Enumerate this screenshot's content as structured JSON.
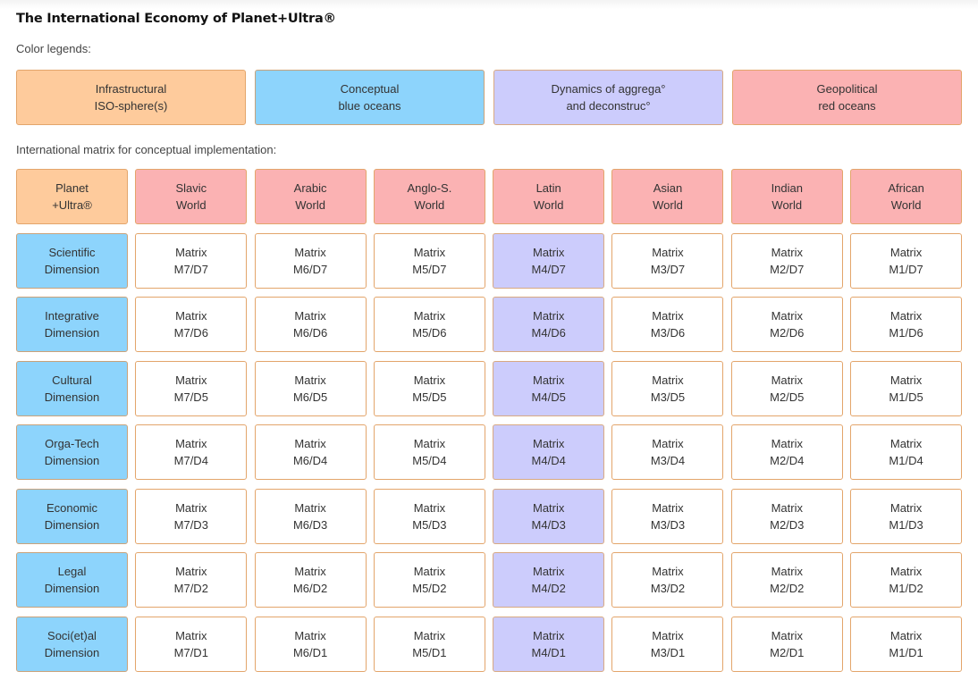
{
  "page": {
    "title": "The International Economy of Planet+Ultra®",
    "legend_heading": "Color legends:",
    "matrix_heading": "International matrix for conceptual implementation:"
  },
  "colors": {
    "infrastructural": "#fecb9c",
    "conceptual": "#8dd4fc",
    "dynamics": "#ccccfc",
    "geopolitical": "#fbb2b3",
    "cell": "#ffffff",
    "border": "#e3a56b"
  },
  "legend": [
    {
      "line1": "Infrastructural",
      "line2": "ISO-sphere(s)",
      "color": "orange"
    },
    {
      "line1": "Conceptual",
      "line2": "blue oceans",
      "color": "blue"
    },
    {
      "line1": "Dynamics of aggrega°",
      "line2": "and deconstruc°",
      "color": "purple"
    },
    {
      "line1": "Geopolitical",
      "line2": "red oceans",
      "color": "red"
    }
  ],
  "matrix": {
    "corner": {
      "line1": "Planet",
      "line2": "+Ultra®"
    },
    "columns": [
      {
        "line1": "Slavic",
        "line2": "World",
        "code": "M7"
      },
      {
        "line1": "Arabic",
        "line2": "World",
        "code": "M6"
      },
      {
        "line1": "Anglo-S.",
        "line2": "World",
        "code": "M5"
      },
      {
        "line1": "Latin",
        "line2": "World",
        "code": "M4"
      },
      {
        "line1": "Asian",
        "line2": "World",
        "code": "M3"
      },
      {
        "line1": "Indian",
        "line2": "World",
        "code": "M2"
      },
      {
        "line1": "African",
        "line2": "World",
        "code": "M1"
      }
    ],
    "highlight_column": "M4",
    "cell_label": "Matrix",
    "rows": [
      {
        "line1": "Scientific",
        "line2": "Dimension",
        "code": "D7"
      },
      {
        "line1": "Integrative",
        "line2": "Dimension",
        "code": "D6"
      },
      {
        "line1": "Cultural",
        "line2": "Dimension",
        "code": "D5"
      },
      {
        "line1": "Orga-Tech",
        "line2": "Dimension",
        "code": "D4"
      },
      {
        "line1": "Economic",
        "line2": "Dimension",
        "code": "D3"
      },
      {
        "line1": "Legal",
        "line2": "Dimension",
        "code": "D2"
      },
      {
        "line1": "Soci(et)al",
        "line2": "Dimension",
        "code": "D1"
      }
    ]
  }
}
